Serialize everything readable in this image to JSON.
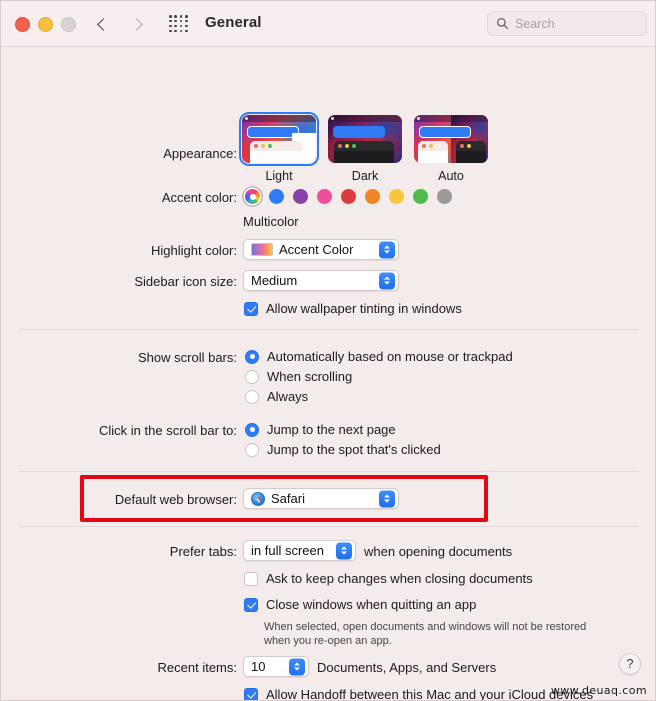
{
  "window": {
    "title": "General",
    "traffic_lights": [
      "close",
      "minimize",
      "zoom"
    ]
  },
  "toolbar": {
    "back_icon": "chevron-left-icon",
    "forward_icon": "chevron-right-icon",
    "grid_icon": "grid-icon",
    "search_placeholder": "Search",
    "search_value": "",
    "search_icon": "search-icon"
  },
  "appearance": {
    "label": "Appearance:",
    "options": [
      {
        "id": "light",
        "caption": "Light",
        "selected": true
      },
      {
        "id": "dark",
        "caption": "Dark",
        "selected": false
      },
      {
        "id": "auto",
        "caption": "Auto",
        "selected": false
      }
    ]
  },
  "accent_color": {
    "label": "Accent color:",
    "caption": "Multicolor",
    "selected_index": 0,
    "swatches": [
      {
        "name": "Multicolor",
        "hex": "multicolor"
      },
      {
        "name": "Blue",
        "hex": "#2f7bf6"
      },
      {
        "name": "Purple",
        "hex": "#8b3fa8"
      },
      {
        "name": "Pink",
        "hex": "#ef4e9b"
      },
      {
        "name": "Red",
        "hex": "#dc3b3b"
      },
      {
        "name": "Orange",
        "hex": "#ef8423"
      },
      {
        "name": "Yellow",
        "hex": "#f7c63c"
      },
      {
        "name": "Green",
        "hex": "#4fb94f"
      },
      {
        "name": "Graphite",
        "hex": "#9c9899"
      }
    ]
  },
  "highlight_color": {
    "label": "Highlight color:",
    "value": "Accent Color"
  },
  "sidebar_icon_size": {
    "label": "Sidebar icon size:",
    "value": "Medium"
  },
  "wallpaper_tinting": {
    "label": "Allow wallpaper tinting in windows",
    "checked": true
  },
  "scroll_bars": {
    "label": "Show scroll bars:",
    "options": [
      {
        "label": "Automatically based on mouse or trackpad",
        "selected": true
      },
      {
        "label": "When scrolling",
        "selected": false
      },
      {
        "label": "Always",
        "selected": false
      }
    ]
  },
  "scroll_bar_click": {
    "label": "Click in the scroll bar to:",
    "options": [
      {
        "label": "Jump to the next page",
        "selected": true
      },
      {
        "label": "Jump to the spot that's clicked",
        "selected": false
      }
    ]
  },
  "default_browser": {
    "label": "Default web browser:",
    "value": "Safari",
    "icon": "safari-icon",
    "highlighted": true,
    "highlight_hex": "#e30613"
  },
  "prefer_tabs": {
    "label": "Prefer tabs:",
    "value": "in full screen",
    "suffix": "when opening documents"
  },
  "ask_keep_changes": {
    "label": "Ask to keep changes when closing documents",
    "checked": false
  },
  "close_windows": {
    "label": "Close windows when quitting an app",
    "checked": true,
    "description_line1": "When selected, open documents and windows will not be restored",
    "description_line2": "when you re-open an app."
  },
  "recent_items": {
    "label": "Recent items:",
    "value": "10",
    "suffix": "Documents, Apps, and Servers"
  },
  "handoff": {
    "label": "Allow Handoff between this Mac and your iCloud devices",
    "checked": true
  },
  "help_button": {
    "glyph": "?"
  },
  "watermark": {
    "text": "www.deuaq.com"
  }
}
